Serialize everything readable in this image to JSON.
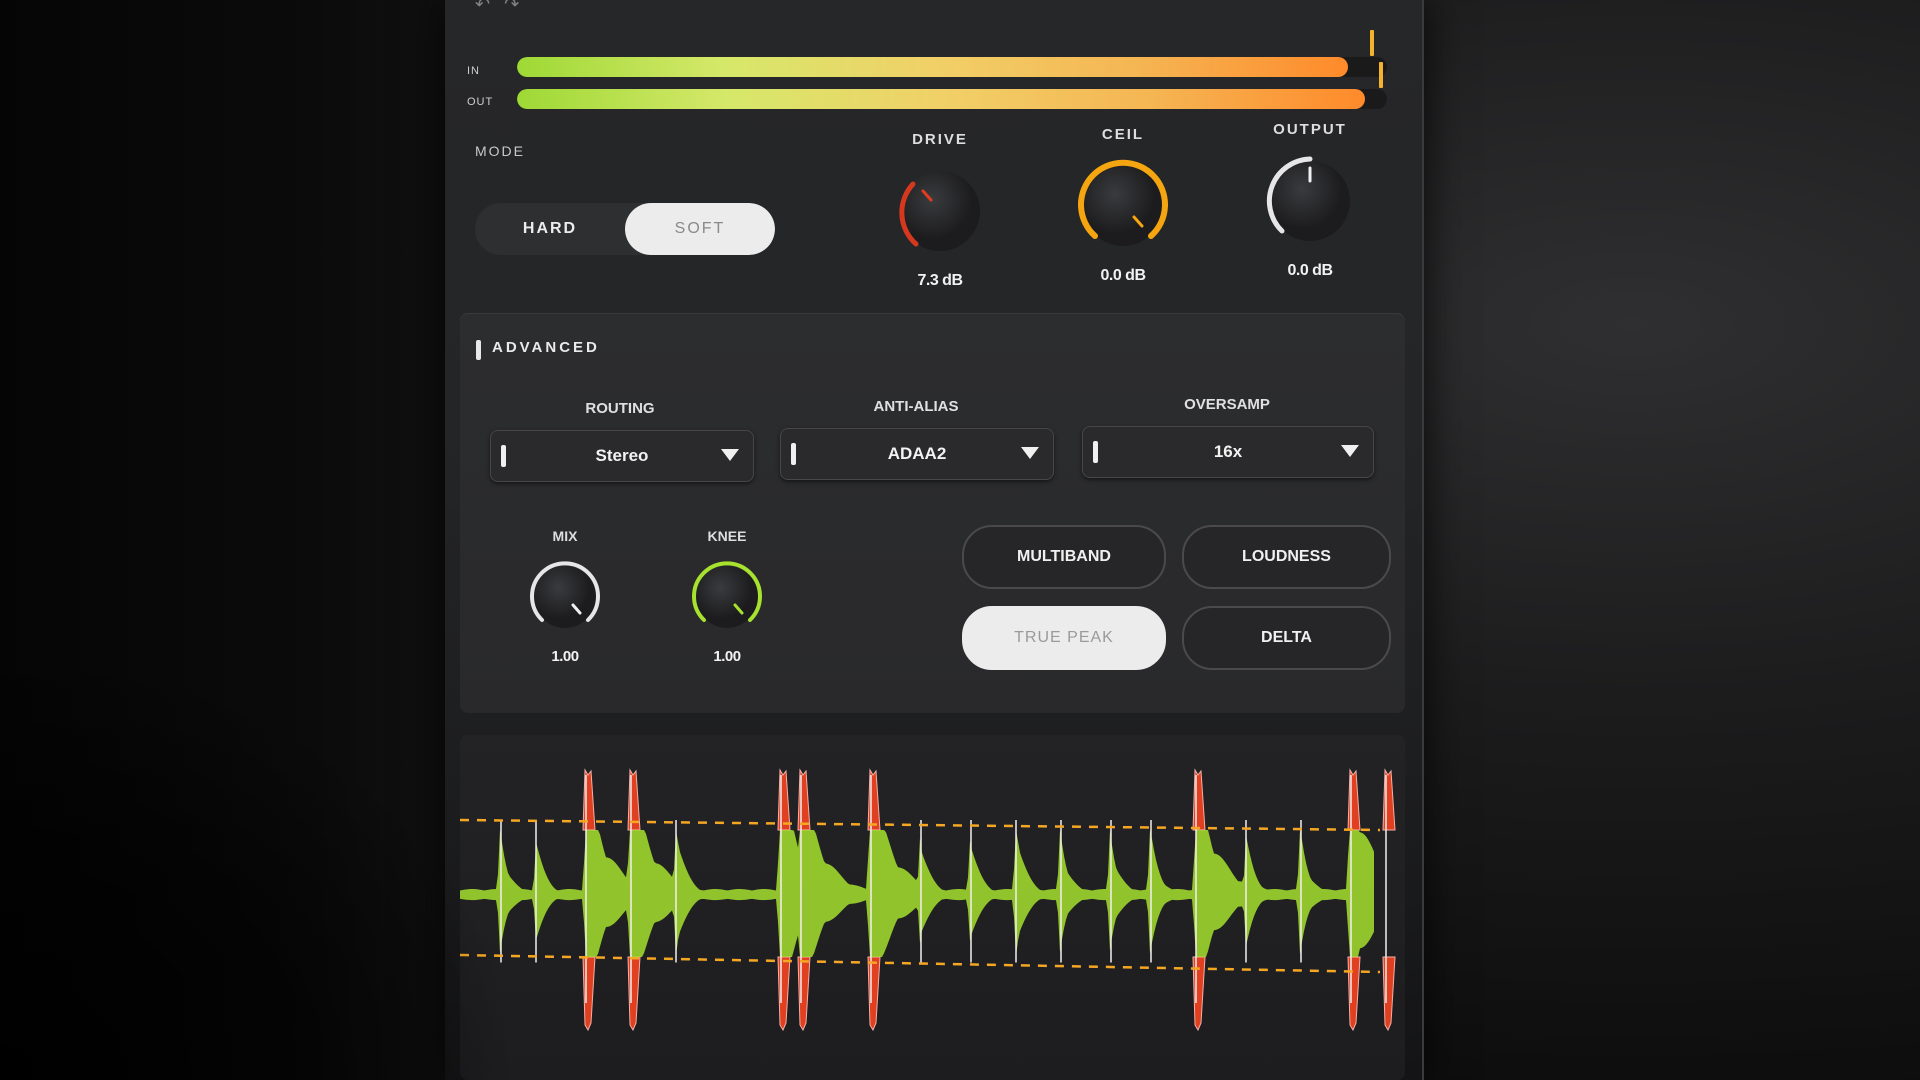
{
  "topbar": {
    "undo_icon": "undo-icon",
    "redo_icon": "redo-icon"
  },
  "meters": {
    "in": {
      "label": "IN",
      "level": 0.985
    },
    "out": {
      "label": "OUT",
      "level": 0.995
    }
  },
  "mode": {
    "label": "MODE",
    "options": [
      "HARD",
      "SOFT"
    ],
    "selected": "SOFT"
  },
  "knobs": {
    "drive": {
      "title": "DRIVE",
      "value": "7.3 dB"
    },
    "ceil": {
      "title": "CEIL",
      "value": "0.0 dB"
    },
    "output": {
      "title": "OUTPUT",
      "value": "0.0 dB"
    },
    "mix": {
      "title": "MIX",
      "value": "1.00"
    },
    "knee": {
      "title": "KNEE",
      "value": "1.00"
    }
  },
  "advanced": {
    "title": "ADVANCED",
    "routing": {
      "label": "ROUTING",
      "value": "Stereo"
    },
    "anti_alias": {
      "label": "ANTI-ALIAS",
      "value": "ADAA2"
    },
    "oversamp": {
      "label": "OVERSAMP",
      "value": "16x"
    },
    "buttons": {
      "multiband": "MULTIBAND",
      "loudness": "LOUDNESS",
      "true_peak": "TRUE PEAK",
      "delta": "DELTA"
    },
    "true_peak_active": true
  },
  "colors": {
    "green": "#a6e22e",
    "orange": "#f5a623",
    "red": "#e0401f",
    "ceiling_line": "#f5a623"
  }
}
